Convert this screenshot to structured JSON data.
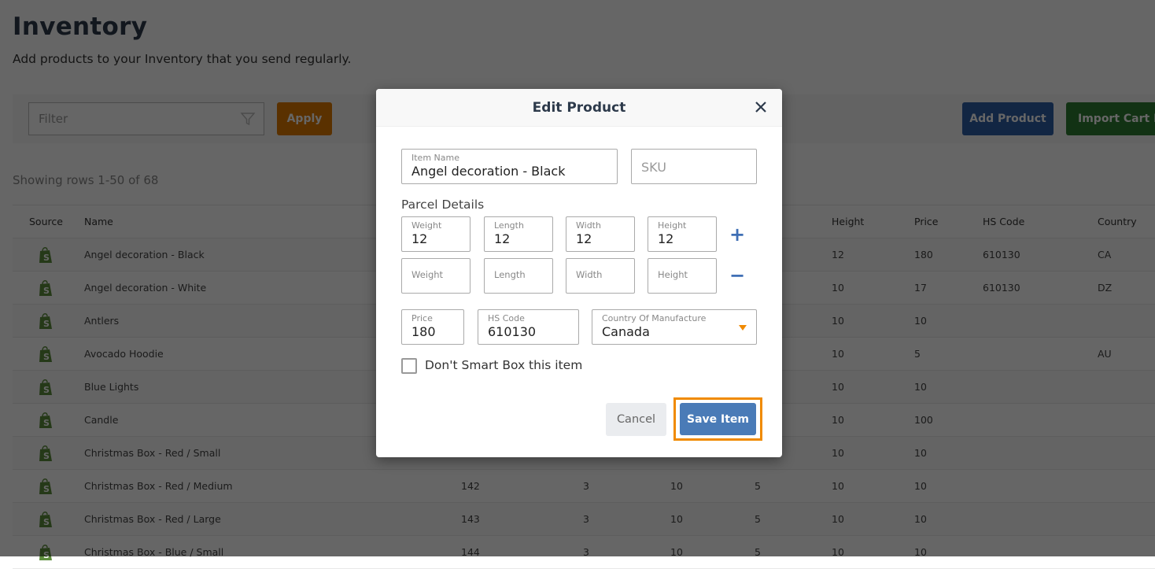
{
  "page": {
    "title": "Inventory",
    "subtitle": "Add products to your Inventory that you send regularly.",
    "filter_placeholder": "Filter",
    "apply_label": "Apply",
    "add_product_label": "Add Product",
    "import_label": "Import Cart Products",
    "rows_count": "Showing rows 1-50 of 68"
  },
  "table": {
    "headers": {
      "source": "Source",
      "name": "Name",
      "height": "Height",
      "price": "Price",
      "hs_code": "HS Code",
      "country": "Country"
    },
    "rows": [
      {
        "name": "Angel decoration - Black",
        "c1": "",
        "c2": "",
        "c3": "",
        "c4": "",
        "height": "12",
        "price": "180",
        "hs": "610130",
        "country": "CA"
      },
      {
        "name": "Angel decoration - White",
        "c1": "",
        "c2": "",
        "c3": "",
        "c4": "",
        "height": "10",
        "price": "17",
        "hs": "610130",
        "country": "DZ"
      },
      {
        "name": "Antlers",
        "c1": "",
        "c2": "",
        "c3": "",
        "c4": "",
        "height": "10",
        "price": "10",
        "hs": "",
        "country": ""
      },
      {
        "name": "Avocado Hoodie",
        "c1": "",
        "c2": "",
        "c3": "",
        "c4": "",
        "height": "10",
        "price": "5",
        "hs": "",
        "country": "AU"
      },
      {
        "name": "Blue Lights",
        "c1": "",
        "c2": "",
        "c3": "",
        "c4": "",
        "height": "10",
        "price": "10",
        "hs": "",
        "country": ""
      },
      {
        "name": "Candle",
        "c1": "",
        "c2": "",
        "c3": "",
        "c4": "",
        "height": "10",
        "price": "100",
        "hs": "",
        "country": ""
      },
      {
        "name": "Christmas Box - Red / Small",
        "c1": "",
        "c2": "",
        "c3": "",
        "c4": "",
        "height": "10",
        "price": "10",
        "hs": "",
        "country": ""
      },
      {
        "name": "Christmas Box - Red / Medium",
        "c1": "142",
        "c2": "3",
        "c3": "10",
        "c4": "5",
        "height": "10",
        "price": "10",
        "hs": "",
        "country": ""
      },
      {
        "name": "Christmas Box - Red / Large",
        "c1": "143",
        "c2": "3",
        "c3": "10",
        "c4": "5",
        "height": "10",
        "price": "10",
        "hs": "",
        "country": ""
      },
      {
        "name": "Christmas Box - Blue / Small",
        "c1": "144",
        "c2": "3",
        "c3": "10",
        "c4": "5",
        "height": "10",
        "price": "10",
        "hs": "",
        "country": ""
      }
    ]
  },
  "modal": {
    "title": "Edit Product",
    "item_name_label": "Item Name",
    "item_name_value": "Angel decoration - Black",
    "sku_placeholder": "SKU",
    "parcel_details_label": "Parcel Details",
    "parcel_1": {
      "weight_label": "Weight",
      "weight": "12",
      "length_label": "Length",
      "length": "12",
      "width_label": "Width",
      "width": "12",
      "height_label": "Height",
      "height": "12"
    },
    "parcel_2": {
      "weight_placeholder": "Weight",
      "length_placeholder": "Length",
      "width_placeholder": "Width",
      "height_placeholder": "Height"
    },
    "add_parcel_icon": "+",
    "remove_parcel_icon": "−",
    "price_label": "Price",
    "price_value": "180",
    "hs_code_label": "HS Code",
    "hs_code_value": "610130",
    "country_label": "Country Of Manufacture",
    "country_value": "Canada",
    "smart_box_label": "Don't Smart Box this item",
    "smart_box_checked": false,
    "cancel_label": "Cancel",
    "save_label": "Save Item"
  },
  "colors": {
    "accent_orange": "#f08a00",
    "primary_blue": "#4a7bb7",
    "shopify_green": "#5e8e3e"
  }
}
